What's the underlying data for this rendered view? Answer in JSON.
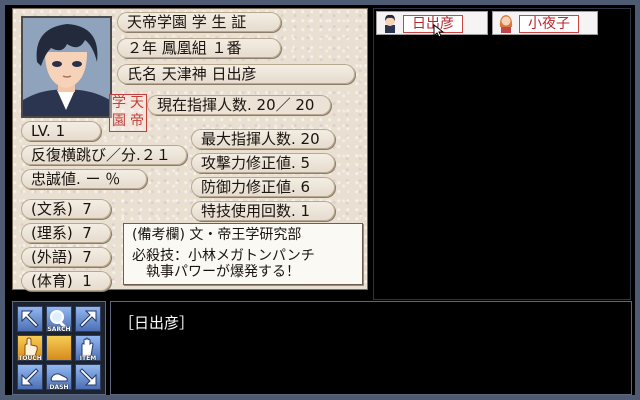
{
  "card": {
    "school_title": "天帝学園 学 生 証",
    "class_line": "２年  鳳凰組   １番",
    "name_line": "氏名  天津神  日出彦",
    "stamp": [
      "学",
      "天",
      "園",
      "帝"
    ],
    "command_count": "現在指揮人数. 20／ 20",
    "level": "LV.  1",
    "repeat_jump": "反復横跳び／分.２１",
    "loyalty": "忠誠値.  ー ％",
    "max_command": "最大指揮人数. 20",
    "attack_mod": "攻撃力修正値.   5",
    "defense_mod": "防御力修正値.   6",
    "skill_uses": "特技使用回数.   1",
    "subjects": [
      {
        "label": "文系",
        "value": "7"
      },
      {
        "label": "理系",
        "value": "7"
      },
      {
        "label": "外語",
        "value": "7"
      },
      {
        "label": "体育",
        "value": "1"
      }
    ],
    "remarks_label": "備考欄",
    "remarks_value": "文・帝王学研究部",
    "special_prefix": "必殺技：小林メガトンパンチ",
    "special_suffix": "執事パワーが爆発する！"
  },
  "party": [
    {
      "name": "日出彦",
      "selected": true
    },
    {
      "name": "小夜子",
      "selected": false
    }
  ],
  "commands": [
    {
      "id": "search",
      "label": "SARCH"
    },
    {
      "id": "touch",
      "label": "TOUCH"
    },
    {
      "id": "item",
      "label": "ITEM"
    },
    {
      "id": "dash",
      "label": "DASH"
    }
  ],
  "message": {
    "speaker": "［日出彦］"
  },
  "colors": {
    "frame": "#4f5a73",
    "card_bg": "#e9e0d2",
    "stamp_red": "#c1403a",
    "tab_text": "#b9272b"
  }
}
